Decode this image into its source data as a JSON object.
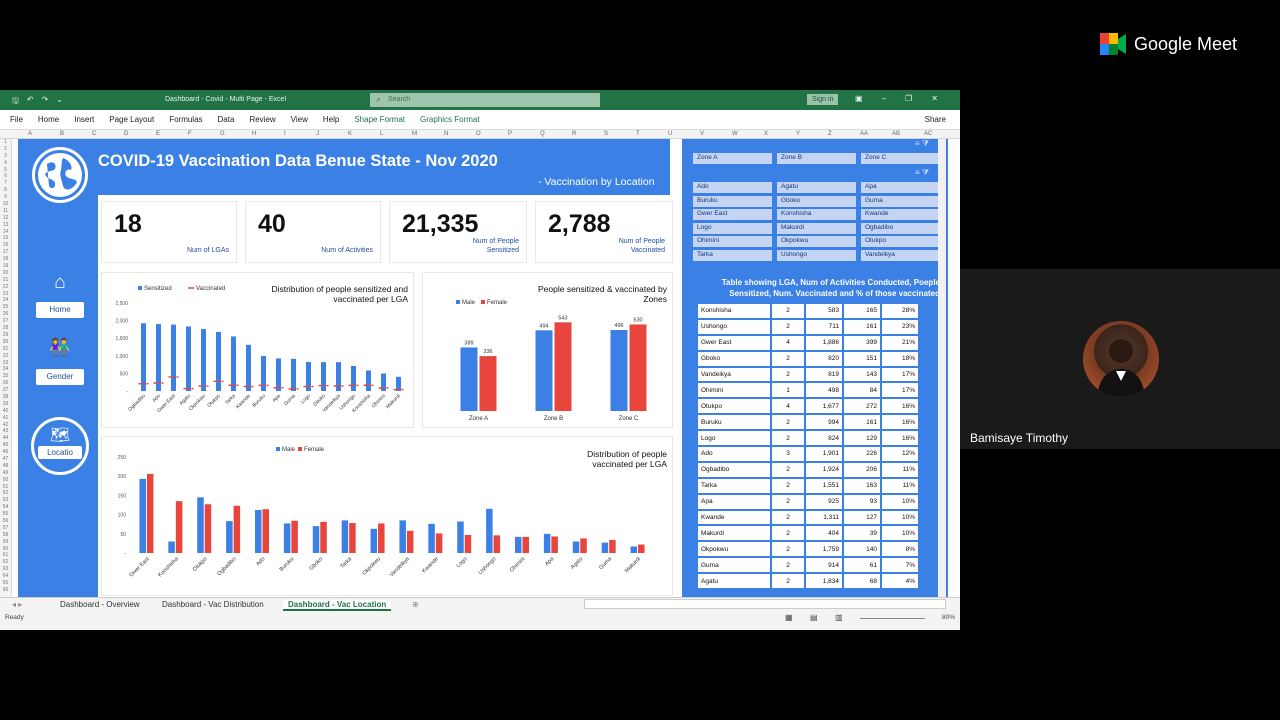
{
  "excel": {
    "doc_title": "Dashboard - Covid - Multi Page - Excel",
    "search_placeholder": "Search",
    "sign_in": "Sign in",
    "share": "Share",
    "menu": [
      "File",
      "Home",
      "Insert",
      "Page Layout",
      "Formulas",
      "Data",
      "Review",
      "View",
      "Help",
      "Shape Format",
      "Graphics Format"
    ],
    "columns": [
      "A",
      "B",
      "C",
      "D",
      "E",
      "F",
      "G",
      "H",
      "I",
      "J",
      "K",
      "L",
      "M",
      "N",
      "O",
      "P",
      "Q",
      "R",
      "S",
      "T",
      "U",
      "V",
      "W",
      "X",
      "Y",
      "Z",
      "AA",
      "AB",
      "AC"
    ],
    "tabs": [
      "Dashboard - Overview",
      "Dashboard - Vac Distribution",
      "Dashboard - Vac Location"
    ],
    "status": "Ready",
    "zoom": "80%"
  },
  "dashboard": {
    "title": "COVID-19 Vaccination Data Benue State - Nov 2020",
    "subtitle": "- Vaccination by Location",
    "nav": {
      "home": "Home",
      "gender": "Gender",
      "location": "Locatio"
    },
    "kpis": [
      {
        "value": "18",
        "label": "Num of LGAs"
      },
      {
        "value": "40",
        "label": "Num of Activities"
      },
      {
        "value": "21,335",
        "label": "Num of People Sensitized"
      },
      {
        "value": "2,788",
        "label": "Num of People Vaccinated"
      }
    ]
  },
  "chart_data": [
    {
      "type": "bar",
      "title": "Distribution of people sensitized and vaccinated per LGA",
      "legend": [
        "Sensitized",
        "Vaccinated"
      ],
      "ylim": [
        0,
        2500
      ],
      "yticks": [
        "2,500",
        "2,000",
        "1,500",
        "1,000",
        "500",
        "-"
      ],
      "categories": [
        "Ogbadibo",
        "Ado",
        "Gwer East",
        "Agatu",
        "Okpokwu",
        "Otukpo",
        "Tarka",
        "Kwande",
        "Buruku",
        "Apa",
        "Guma",
        "Logo",
        "Gboko",
        "Vandeikya",
        "Ushongo",
        "Konshisha",
        "Ohimini",
        "Makurdi"
      ],
      "series": [
        {
          "name": "Sensitized",
          "values": [
            1924,
            1901,
            1886,
            1834,
            1759,
            1677,
            1551,
            1311,
            994,
            925,
            914,
            824,
            820,
            819,
            711,
            583,
            498,
            404
          ]
        },
        {
          "name": "Vaccinated",
          "values": [
            206,
            226,
            399,
            68,
            140,
            272,
            163,
            127,
            161,
            93,
            61,
            129,
            151,
            143,
            161,
            165,
            84,
            39
          ]
        }
      ]
    },
    {
      "type": "bar",
      "title": "People sensitized & vaccinated by Zones",
      "legend": [
        "Male",
        "Female"
      ],
      "categories": [
        "Zone A",
        "Zone B",
        "Zone C"
      ],
      "series": [
        {
          "name": "Male",
          "values": [
            389,
            494,
            496
          ]
        },
        {
          "name": "Female",
          "values": [
            336,
            543,
            530
          ]
        }
      ]
    },
    {
      "type": "bar",
      "title": "Distribution of people vaccinated per LGA",
      "legend": [
        "Male",
        "Female"
      ],
      "ylim": [
        0,
        250
      ],
      "yticks": [
        "250",
        "200",
        "150",
        "100",
        "50",
        "-"
      ],
      "categories": [
        "Gwer East",
        "Konshisha",
        "Otukpo",
        "Ogbadibo",
        "Ado",
        "Buruku",
        "Gboko",
        "Tarka",
        "Okpokwu",
        "Vandeikya",
        "Kwande",
        "Logo",
        "Ushongo",
        "Ohimini",
        "Apa",
        "Agatu",
        "Guma",
        "Makurdi"
      ],
      "series": [
        {
          "name": "Male",
          "values": [
            193,
            30,
            145,
            83,
            112,
            77,
            70,
            85,
            63,
            85,
            76,
            82,
            115,
            42,
            50,
            30,
            27,
            17
          ]
        },
        {
          "name": "Female",
          "values": [
            206,
            135,
            127,
            123,
            114,
            84,
            81,
            78,
            77,
            58,
            51,
            47,
            46,
            42,
            43,
            38,
            34,
            22
          ]
        }
      ]
    }
  ],
  "slicers": {
    "zones": [
      "Zone A",
      "Zone B",
      "Zone C"
    ],
    "lgas": [
      "Ado",
      "Agatu",
      "Apa",
      "Buruku",
      "Gboko",
      "Guma",
      "Gwer East",
      "Konshisha",
      "Kwande",
      "Logo",
      "Makurdi",
      "Ogbadibo",
      "Ohimini",
      "Okpokwu",
      "Otukpo",
      "Tarka",
      "Ushongo",
      "Vandeikya"
    ]
  },
  "table": {
    "title": "Table showing LGA, Num of Activities Conducted, Poeple Sensitized, Num. Vaccinated and % of those vaccinated",
    "rows": [
      [
        "Konshisha",
        "2",
        "583",
        "165",
        "28%"
      ],
      [
        "Ushongo",
        "2",
        "711",
        "161",
        "23%"
      ],
      [
        "Gwer East",
        "4",
        "1,886",
        "399",
        "21%"
      ],
      [
        "Gboko",
        "2",
        "820",
        "151",
        "18%"
      ],
      [
        "Vandeikya",
        "2",
        "819",
        "143",
        "17%"
      ],
      [
        "Ohimini",
        "1",
        "498",
        "84",
        "17%"
      ],
      [
        "Otukpo",
        "4",
        "1,677",
        "272",
        "16%"
      ],
      [
        "Buruku",
        "2",
        "994",
        "161",
        "16%"
      ],
      [
        "Logo",
        "2",
        "824",
        "129",
        "16%"
      ],
      [
        "Ado",
        "3",
        "1,901",
        "226",
        "12%"
      ],
      [
        "Ogbadibo",
        "2",
        "1,924",
        "206",
        "11%"
      ],
      [
        "Tarka",
        "2",
        "1,551",
        "163",
        "11%"
      ],
      [
        "Apa",
        "2",
        "925",
        "93",
        "10%"
      ],
      [
        "Kwande",
        "2",
        "1,311",
        "127",
        "10%"
      ],
      [
        "Makurdi",
        "2",
        "404",
        "39",
        "10%"
      ],
      [
        "Okpokwu",
        "2",
        "1,759",
        "140",
        "8%"
      ],
      [
        "Guma",
        "2",
        "914",
        "61",
        "7%"
      ],
      [
        "Agatu",
        "2",
        "1,834",
        "68",
        "4%"
      ]
    ]
  },
  "meet": {
    "brand": "Google Meet",
    "participant": "Bamisaye Timothy"
  },
  "colors": {
    "dashboard": "#3b80e4",
    "male": "#3b80e4",
    "female": "#e8453c",
    "excel": "#217346"
  }
}
